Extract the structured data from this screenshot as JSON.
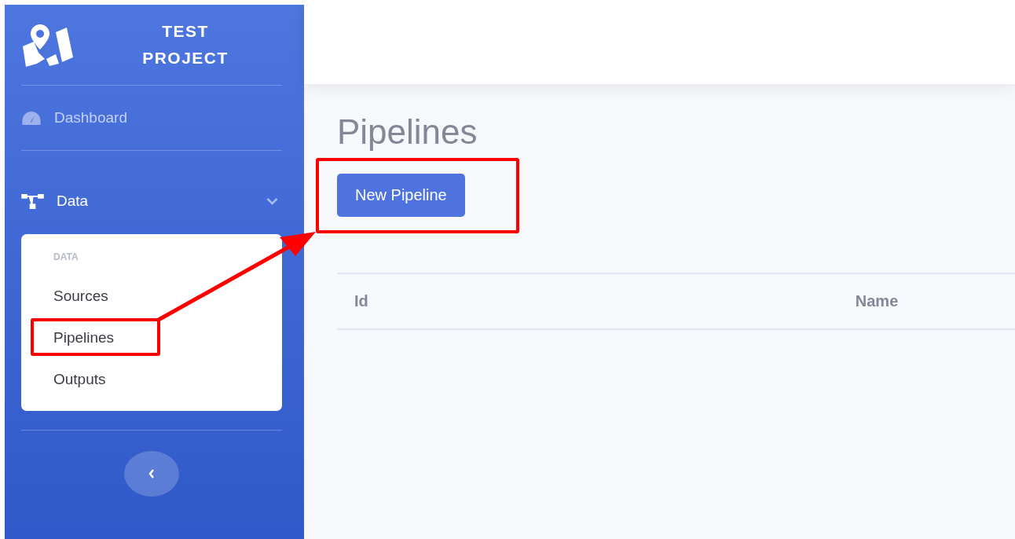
{
  "brand": {
    "title_lines": [
      "TEST",
      "PROJECT"
    ]
  },
  "sidebar": {
    "items": [
      {
        "label": "Dashboard",
        "kind": "link"
      },
      {
        "label": "Data",
        "kind": "group",
        "expanded": true,
        "children_heading": "DATA",
        "children": [
          {
            "label": "Sources"
          },
          {
            "label": "Pipelines"
          },
          {
            "label": "Outputs"
          }
        ]
      }
    ]
  },
  "page": {
    "title": "Pipelines",
    "button": "New Pipeline"
  },
  "table": {
    "columns": [
      "Id",
      "Name"
    ]
  }
}
